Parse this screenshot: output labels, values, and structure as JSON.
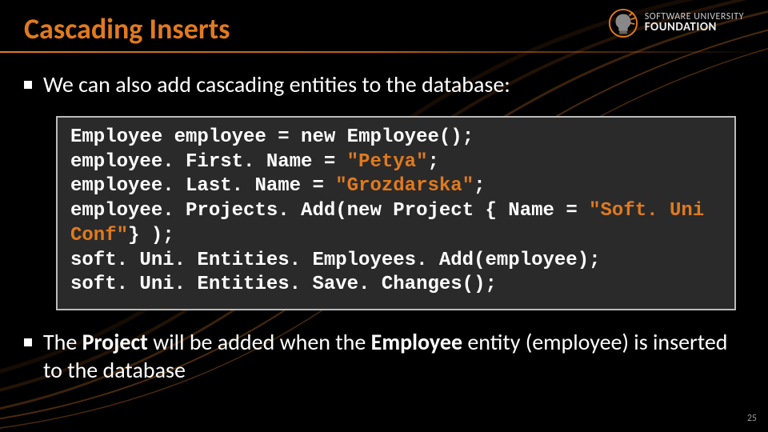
{
  "header": {
    "title": "Cascading Inserts",
    "logo": {
      "line1": "SOFTWARE UNIVERSITY",
      "line2": "FOUNDATION"
    }
  },
  "bullets": {
    "b1": "We can also add cascading entities to the database:",
    "b2_pre": "The ",
    "b2_proj": "Project",
    "b2_mid": " will be added when the ",
    "b2_emp": "Employee",
    "b2_post": " entity (employee) is inserted to the database"
  },
  "code": {
    "l1a": "Employee employee = ",
    "l1b": "new",
    "l1c": " Employee();",
    "l2a": "employee. First. Name = ",
    "l2b": "\"Petya\"",
    "l2c": ";",
    "l3a": "employee. Last. Name = ",
    "l3b": "\"Grozdarska\"",
    "l3c": ";",
    "l4a": "employee. Projects. Add(",
    "l4b": "new",
    "l4c": " Project { Name = ",
    "l4d": "\"Soft. Uni Conf\"",
    "l4e": "} );",
    "l5": "soft. Uni. Entities. Employees. Add(employee);",
    "l6": "soft. Uni. Entities. Save. Changes();"
  },
  "page_number": "25"
}
